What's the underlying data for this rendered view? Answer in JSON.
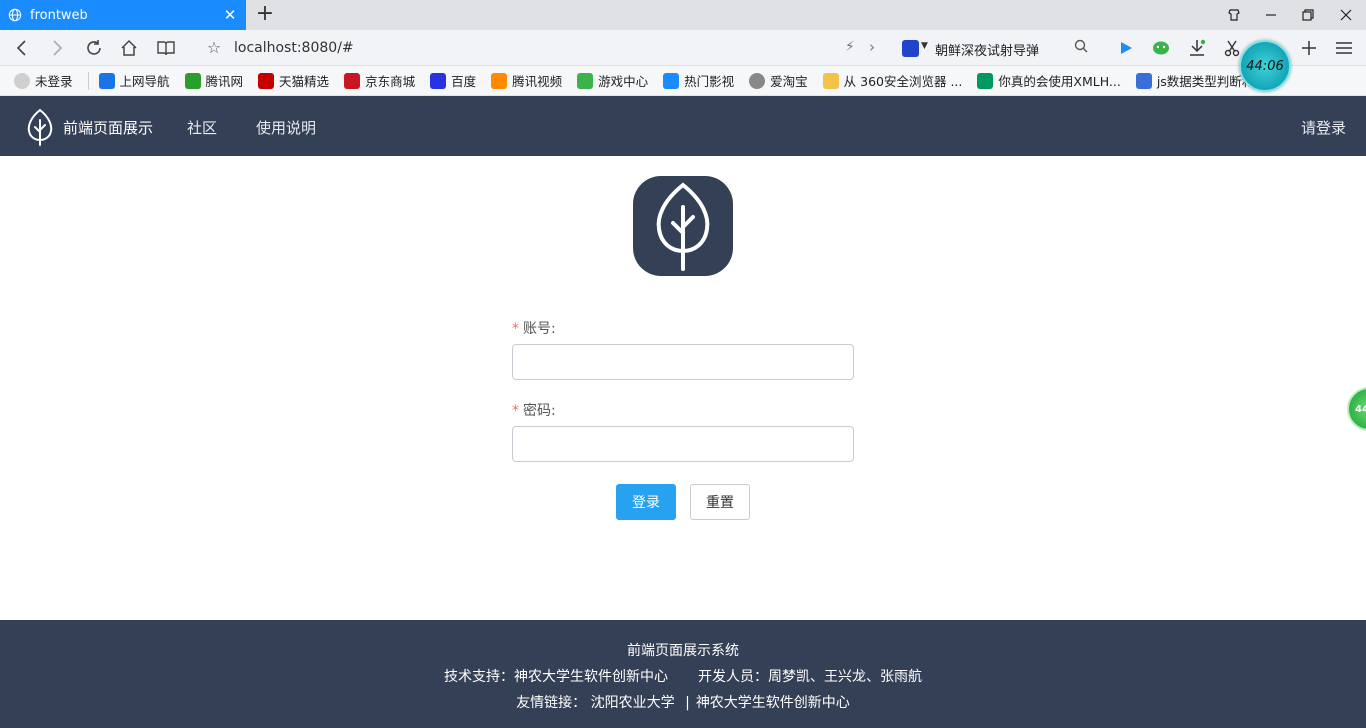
{
  "browser": {
    "tab_title": "frontweb",
    "tab_close": "✕",
    "new_tab": "+",
    "url": "localhost:8080/#",
    "news_ticker": "朝鲜深夜试射导弹",
    "clock_time": "44:06",
    "float_ball_text": "44"
  },
  "bookmarks": [
    {
      "label": "未登录",
      "icon": "user-icon",
      "color": "#cfcfcf"
    },
    {
      "label": "上网导航",
      "icon": "ie-icon",
      "color": "#1a73e8"
    },
    {
      "label": "腾讯网",
      "icon": "tencent-icon",
      "color": "#2a9d2a"
    },
    {
      "label": "天猫精选",
      "icon": "tmall-icon",
      "color": "#c40000"
    },
    {
      "label": "京东商城",
      "icon": "jd-icon",
      "color": "#c81623"
    },
    {
      "label": "百度",
      "icon": "baidu-icon",
      "color": "#2932e1"
    },
    {
      "label": "腾讯视频",
      "icon": "tencent-video-icon",
      "color": "#ff8a00"
    },
    {
      "label": "游戏中心",
      "icon": "gamepad-icon",
      "color": "#3bb34a"
    },
    {
      "label": "热门影视",
      "icon": "play-icon",
      "color": "#1a8cff"
    },
    {
      "label": "爱淘宝",
      "icon": "globe-icon",
      "color": "#888888"
    },
    {
      "label": "从 360安全浏览器 ...",
      "icon": "folder-icon",
      "color": "#f2c24b"
    },
    {
      "label": "你真的会使用XMLH...",
      "icon": "sf-icon",
      "color": "#009a61"
    },
    {
      "label": "js数据类型判断和数",
      "icon": "site-icon",
      "color": "#3b6fd8"
    }
  ],
  "nav": {
    "brand": "前端页面展示",
    "links": [
      "社区",
      "使用说明"
    ],
    "login": "请登录"
  },
  "form": {
    "required_mark": "*",
    "account_label": "账号:",
    "account_value": "",
    "password_label": "密码:",
    "password_value": "",
    "login_button": "登录",
    "reset_button": "重置"
  },
  "footer": {
    "title": "前端页面展示系统",
    "support": "技术支持：神农大学生软件创新中心",
    "developers": "开发人员：周梦凯、王兴龙、张雨航",
    "links_label": "友情链接：",
    "links": [
      "沈阳农业大学",
      "神农大学生软件创新中心"
    ],
    "separator": "|"
  },
  "colors": {
    "nav_bg": "#344056",
    "primary": "#26a2f0",
    "required": "#f56c6c",
    "tab_active": "#1a8cff"
  }
}
